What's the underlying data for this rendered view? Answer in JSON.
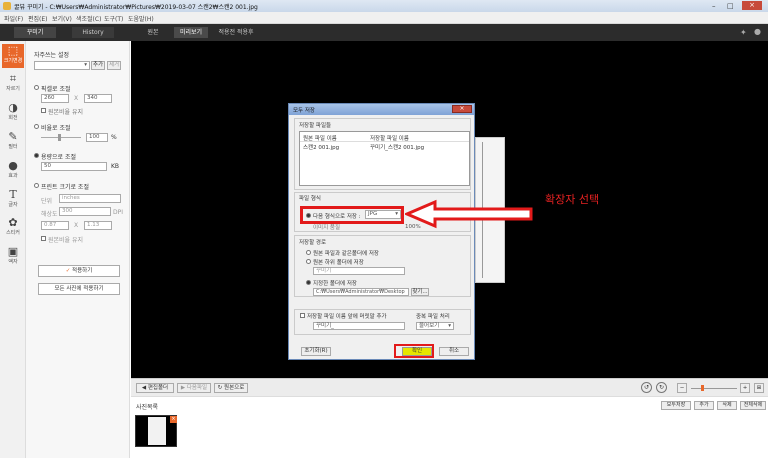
{
  "window": {
    "title": "꿀뷰 꾸미기 - C:₩Users₩Administrator₩Pictures₩2019-03-07 스캔2₩스캔2 001.jpg"
  },
  "menu": [
    "파일(F)",
    "편집(E)",
    "보기(V)",
    "색조절(C)",
    "도구(T)",
    "도움말(H)"
  ],
  "tabs": {
    "left": [
      "꾸미기",
      "History"
    ],
    "main": [
      "원본",
      "미리보기",
      "적용전 적용후"
    ]
  },
  "sidebar": [
    {
      "label": "크기변경",
      "icon": "resize-icon"
    },
    {
      "label": "자르기",
      "icon": "crop-icon"
    },
    {
      "label": "회전",
      "icon": "rotate-icon"
    },
    {
      "label": "필터",
      "icon": "filter-icon"
    },
    {
      "label": "효과",
      "icon": "effect-icon"
    },
    {
      "label": "글자",
      "icon": "text-icon"
    },
    {
      "label": "스티커",
      "icon": "sticker-icon"
    },
    {
      "label": "액자",
      "icon": "frame-icon"
    }
  ],
  "panel": {
    "favorites": "자주쓰는 설정",
    "add": "추가",
    "remove": "제거",
    "pixel": "픽셀로 조절",
    "w": "260",
    "h": "340",
    "keep1": "원본비율 유지",
    "ratio": "비율로 조절",
    "ratio_val": "100",
    "pct": "%",
    "capacity": "용량으로 조절",
    "cap_val": "50",
    "kb": "KB",
    "print": "프린트 크기로 조절",
    "unit_lbl": "단위",
    "unit_val": "inches",
    "res_lbl": "해상도",
    "res_val": "300",
    "dpi": "DPI",
    "pw": "0.87",
    "ph": "1.13",
    "keep2": "원본비율 유지",
    "apply": "적용하기",
    "apply_all": "모든 사진에 적용하기"
  },
  "dialog": {
    "title": "모두 저장",
    "files_group": "저장할 파일들",
    "col1": "원본 파일 이름",
    "col2": "저장할 파일 이름",
    "row_src": "스캔2 001.jpg",
    "row_dst": "꾸미기_스캔2 001.jpg",
    "format_group": "파일 형식",
    "format_opt": "다음 형식으로 저장 :",
    "format_val": "JPG",
    "quality_lbl": "이미지 품질",
    "quality_val": "100%",
    "path_group": "저장할 경로",
    "path_opt1": "원본 파일과 같은폴더에 저장",
    "path_opt2": "원본 하위 폴더에 저장",
    "subfolder": "꾸미기",
    "path_opt3": "지정한 폴더에 저장",
    "path_val": "C:₩Users₩Administrator₩Desktop",
    "browse": "찾기...",
    "prefix_chk": "저장할 파일 이름 앞에 머릿말 추가",
    "prefix_val": "꾸미기_",
    "dup_lbl": "중복 파일 처리",
    "dup_val": "물어보기",
    "reset": "초기화(R)",
    "ok": "확인",
    "cancel": "취소"
  },
  "annotation": {
    "text": "확장자 선택"
  },
  "bottombar": {
    "open": "편집폴더",
    "next": "다음파일",
    "reset": "원본으로"
  },
  "filmstrip": {
    "title": "사진목록",
    "actions": [
      "모두저장",
      "추가",
      "삭제",
      "전체삭제"
    ]
  }
}
